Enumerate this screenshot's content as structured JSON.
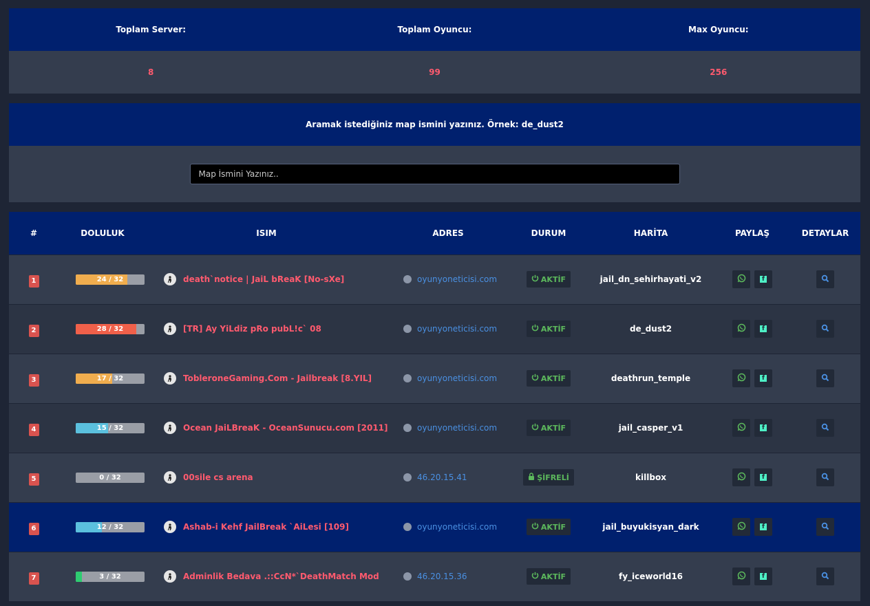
{
  "stats": {
    "headers": [
      "Toplam Server:",
      "Toplam Oyuncu:",
      "Max Oyuncu:"
    ],
    "values": [
      "8",
      "99",
      "256"
    ]
  },
  "search": {
    "label": "Aramak istediğiniz map ismini yazınız. Örnek: de_dust2",
    "placeholder": "Map İsmini Yazınız.."
  },
  "table": {
    "columns": [
      "#",
      "DOLULUK",
      "ISIM",
      "ADRES",
      "DURUM",
      "HARİTA",
      "PAYLAŞ",
      "DETAYLAR"
    ],
    "rows": [
      {
        "rank": "1",
        "fill": "24 / 32",
        "fill_ratio": 0.75,
        "fill_color": "#f0ad4e",
        "name": "death`notice | JaiL bReaK [No-sXe]",
        "address": "oyunyoneticisi.com",
        "status": "AKTİF",
        "status_type": "active",
        "map": "jail_dn_sehirhayati_v2",
        "style": "dark"
      },
      {
        "rank": "2",
        "fill": "28 / 32",
        "fill_ratio": 0.875,
        "fill_color": "#f0604a",
        "name": "[TR] Ay YiLdiz pRo pubL!c` 08",
        "address": "oyunyoneticisi.com",
        "status": "AKTİF",
        "status_type": "active",
        "map": "de_dust2",
        "style": "darker"
      },
      {
        "rank": "3",
        "fill": "17 / 32",
        "fill_ratio": 0.53,
        "fill_color": "#f0ad4e",
        "name": "TobleroneGaming.Com - Jailbreak [8.YIL]",
        "address": "oyunyoneticisi.com",
        "status": "AKTİF",
        "status_type": "active",
        "map": "deathrun_temple",
        "style": "dark"
      },
      {
        "rank": "4",
        "fill": "15 / 32",
        "fill_ratio": 0.47,
        "fill_color": "#5bc0de",
        "name": "Ocean JaiLBreaK - OceanSunucu.com [2011]",
        "address": "oyunyoneticisi.com",
        "status": "AKTİF",
        "status_type": "active",
        "map": "jail_casper_v1",
        "style": "darker"
      },
      {
        "rank": "5",
        "fill": "0 / 32",
        "fill_ratio": 0,
        "fill_color": "#5bc0de",
        "name": "00sile cs arena",
        "address": "46.20.15.41",
        "status": "ŞİFRELİ",
        "status_type": "locked",
        "map": "killbox",
        "style": "dark"
      },
      {
        "rank": "6",
        "fill": "12 / 32",
        "fill_ratio": 0.375,
        "fill_color": "#5bc0de",
        "name": "Ashab-i Kehf JailBreak `AiLesi [109]",
        "address": "oyunyoneticisi.com",
        "status": "AKTİF",
        "status_type": "active",
        "map": "jail_buyukisyan_dark",
        "style": "hl"
      },
      {
        "rank": "7",
        "fill": "3 / 32",
        "fill_ratio": 0.09,
        "fill_color": "#2ecc71",
        "name": "Adminlik Bedava .::CcN*`DeathMatch Mod",
        "address": "46.20.15.36",
        "status": "AKTİF",
        "status_type": "active",
        "map": "fy_iceworld16",
        "style": "dark"
      }
    ]
  },
  "icons": {
    "game": "counter-strike-icon",
    "address": "steam-icon",
    "active": "power-icon",
    "locked": "lock-icon",
    "share_whatsapp": "whatsapp-icon",
    "share_facebook": "facebook-icon",
    "details": "search-icon"
  }
}
